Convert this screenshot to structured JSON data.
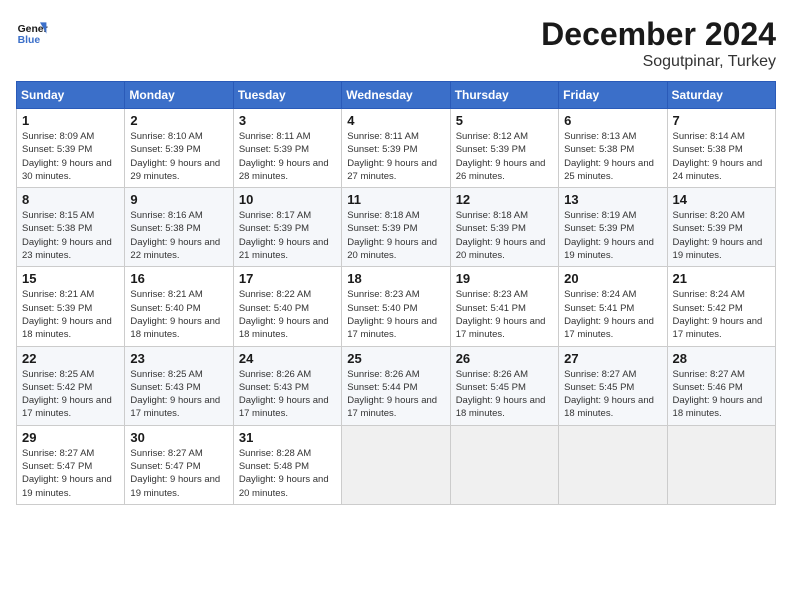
{
  "header": {
    "logo_line1": "General",
    "logo_line2": "Blue",
    "title": "December 2024",
    "subtitle": "Sogutpinar, Turkey"
  },
  "calendar": {
    "headers": [
      "Sunday",
      "Monday",
      "Tuesday",
      "Wednesday",
      "Thursday",
      "Friday",
      "Saturday"
    ],
    "weeks": [
      [
        null,
        null,
        null,
        null,
        {
          "day": "1",
          "sunrise": "Sunrise: 8:09 AM",
          "sunset": "Sunset: 5:39 PM",
          "daylight": "Daylight: 9 hours and 30 minutes."
        },
        {
          "day": "2",
          "sunrise": "Sunrise: 8:10 AM",
          "sunset": "Sunset: 5:39 PM",
          "daylight": "Daylight: 9 hours and 29 minutes."
        },
        {
          "day": "3",
          "sunrise": "Sunrise: 8:11 AM",
          "sunset": "Sunset: 5:39 PM",
          "daylight": "Daylight: 9 hours and 28 minutes."
        },
        {
          "day": "4",
          "sunrise": "Sunrise: 8:11 AM",
          "sunset": "Sunset: 5:39 PM",
          "daylight": "Daylight: 9 hours and 27 minutes."
        },
        {
          "day": "5",
          "sunrise": "Sunrise: 8:12 AM",
          "sunset": "Sunset: 5:39 PM",
          "daylight": "Daylight: 9 hours and 26 minutes."
        },
        {
          "day": "6",
          "sunrise": "Sunrise: 8:13 AM",
          "sunset": "Sunset: 5:38 PM",
          "daylight": "Daylight: 9 hours and 25 minutes."
        },
        {
          "day": "7",
          "sunrise": "Sunrise: 8:14 AM",
          "sunset": "Sunset: 5:38 PM",
          "daylight": "Daylight: 9 hours and 24 minutes."
        }
      ],
      [
        {
          "day": "8",
          "sunrise": "Sunrise: 8:15 AM",
          "sunset": "Sunset: 5:38 PM",
          "daylight": "Daylight: 9 hours and 23 minutes."
        },
        {
          "day": "9",
          "sunrise": "Sunrise: 8:16 AM",
          "sunset": "Sunset: 5:38 PM",
          "daylight": "Daylight: 9 hours and 22 minutes."
        },
        {
          "day": "10",
          "sunrise": "Sunrise: 8:17 AM",
          "sunset": "Sunset: 5:39 PM",
          "daylight": "Daylight: 9 hours and 21 minutes."
        },
        {
          "day": "11",
          "sunrise": "Sunrise: 8:18 AM",
          "sunset": "Sunset: 5:39 PM",
          "daylight": "Daylight: 9 hours and 20 minutes."
        },
        {
          "day": "12",
          "sunrise": "Sunrise: 8:18 AM",
          "sunset": "Sunset: 5:39 PM",
          "daylight": "Daylight: 9 hours and 20 minutes."
        },
        {
          "day": "13",
          "sunrise": "Sunrise: 8:19 AM",
          "sunset": "Sunset: 5:39 PM",
          "daylight": "Daylight: 9 hours and 19 minutes."
        },
        {
          "day": "14",
          "sunrise": "Sunrise: 8:20 AM",
          "sunset": "Sunset: 5:39 PM",
          "daylight": "Daylight: 9 hours and 19 minutes."
        }
      ],
      [
        {
          "day": "15",
          "sunrise": "Sunrise: 8:21 AM",
          "sunset": "Sunset: 5:39 PM",
          "daylight": "Daylight: 9 hours and 18 minutes."
        },
        {
          "day": "16",
          "sunrise": "Sunrise: 8:21 AM",
          "sunset": "Sunset: 5:40 PM",
          "daylight": "Daylight: 9 hours and 18 minutes."
        },
        {
          "day": "17",
          "sunrise": "Sunrise: 8:22 AM",
          "sunset": "Sunset: 5:40 PM",
          "daylight": "Daylight: 9 hours and 18 minutes."
        },
        {
          "day": "18",
          "sunrise": "Sunrise: 8:23 AM",
          "sunset": "Sunset: 5:40 PM",
          "daylight": "Daylight: 9 hours and 17 minutes."
        },
        {
          "day": "19",
          "sunrise": "Sunrise: 8:23 AM",
          "sunset": "Sunset: 5:41 PM",
          "daylight": "Daylight: 9 hours and 17 minutes."
        },
        {
          "day": "20",
          "sunrise": "Sunrise: 8:24 AM",
          "sunset": "Sunset: 5:41 PM",
          "daylight": "Daylight: 9 hours and 17 minutes."
        },
        {
          "day": "21",
          "sunrise": "Sunrise: 8:24 AM",
          "sunset": "Sunset: 5:42 PM",
          "daylight": "Daylight: 9 hours and 17 minutes."
        }
      ],
      [
        {
          "day": "22",
          "sunrise": "Sunrise: 8:25 AM",
          "sunset": "Sunset: 5:42 PM",
          "daylight": "Daylight: 9 hours and 17 minutes."
        },
        {
          "day": "23",
          "sunrise": "Sunrise: 8:25 AM",
          "sunset": "Sunset: 5:43 PM",
          "daylight": "Daylight: 9 hours and 17 minutes."
        },
        {
          "day": "24",
          "sunrise": "Sunrise: 8:26 AM",
          "sunset": "Sunset: 5:43 PM",
          "daylight": "Daylight: 9 hours and 17 minutes."
        },
        {
          "day": "25",
          "sunrise": "Sunrise: 8:26 AM",
          "sunset": "Sunset: 5:44 PM",
          "daylight": "Daylight: 9 hours and 17 minutes."
        },
        {
          "day": "26",
          "sunrise": "Sunrise: 8:26 AM",
          "sunset": "Sunset: 5:45 PM",
          "daylight": "Daylight: 9 hours and 18 minutes."
        },
        {
          "day": "27",
          "sunrise": "Sunrise: 8:27 AM",
          "sunset": "Sunset: 5:45 PM",
          "daylight": "Daylight: 9 hours and 18 minutes."
        },
        {
          "day": "28",
          "sunrise": "Sunrise: 8:27 AM",
          "sunset": "Sunset: 5:46 PM",
          "daylight": "Daylight: 9 hours and 18 minutes."
        }
      ],
      [
        {
          "day": "29",
          "sunrise": "Sunrise: 8:27 AM",
          "sunset": "Sunset: 5:47 PM",
          "daylight": "Daylight: 9 hours and 19 minutes."
        },
        {
          "day": "30",
          "sunrise": "Sunrise: 8:27 AM",
          "sunset": "Sunset: 5:47 PM",
          "daylight": "Daylight: 9 hours and 19 minutes."
        },
        {
          "day": "31",
          "sunrise": "Sunrise: 8:28 AM",
          "sunset": "Sunset: 5:48 PM",
          "daylight": "Daylight: 9 hours and 20 minutes."
        },
        null,
        null,
        null,
        null
      ]
    ]
  }
}
